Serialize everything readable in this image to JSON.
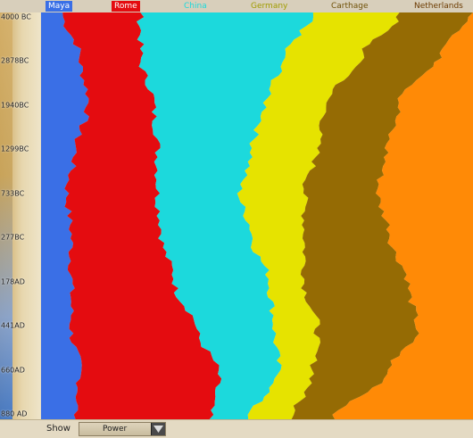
{
  "legend": [
    {
      "name": "Maya",
      "color": "#3a6fe6",
      "text_color": "#ffffff"
    },
    {
      "name": "Rome",
      "color": "#e40c10",
      "text_color": "#ffffff"
    },
    {
      "name": "China",
      "color": "#1cd9dc",
      "text_color": "#1cd9dc"
    },
    {
      "name": "Germany",
      "color": "#e6e300",
      "text_color": "#a09c00"
    },
    {
      "name": "Carthage",
      "color": "#956b04",
      "text_color": "#6f5108"
    },
    {
      "name": "Netherlands",
      "color": "#ff8a06",
      "text_color": "#6b3a00"
    }
  ],
  "time_axis": [
    "4000 BC",
    "2878BC",
    "1940BC",
    "1299BC",
    "733BC",
    "277BC",
    "178AD",
    "441AD",
    "660AD",
    "880 AD"
  ],
  "chart_data": {
    "type": "area",
    "stacked": true,
    "normalized": true,
    "orientation": "vertical-time-axis",
    "x": [
      "4000 BC",
      "2878BC",
      "1940BC",
      "1299BC",
      "733BC",
      "277BC",
      "178AD",
      "441AD",
      "660AD",
      "880 AD"
    ],
    "series": [
      {
        "name": "Maya",
        "values": [
          5,
          9,
          11,
          8,
          6,
          7,
          7,
          7,
          9,
          8
        ]
      },
      {
        "name": "Rome",
        "values": [
          18,
          14,
          15,
          19,
          21,
          21,
          24,
          29,
          32,
          31
        ]
      },
      {
        "name": "China",
        "values": [
          40,
          33,
          26,
          22,
          19,
          21,
          22,
          18,
          14,
          9
        ]
      },
      {
        "name": "Germany",
        "values": [
          20,
          18,
          14,
          15,
          15,
          12,
          8,
          10,
          8,
          10
        ]
      },
      {
        "name": "Carthage",
        "values": [
          17,
          18,
          17,
          16,
          17,
          20,
          24,
          23,
          17,
          10
        ]
      },
      {
        "name": "Netherlands",
        "values": [
          0,
          8,
          17,
          20,
          22,
          19,
          15,
          13,
          20,
          32
        ]
      }
    ]
  },
  "footer": {
    "show_label": "Show",
    "dropdown_value": "Power"
  }
}
